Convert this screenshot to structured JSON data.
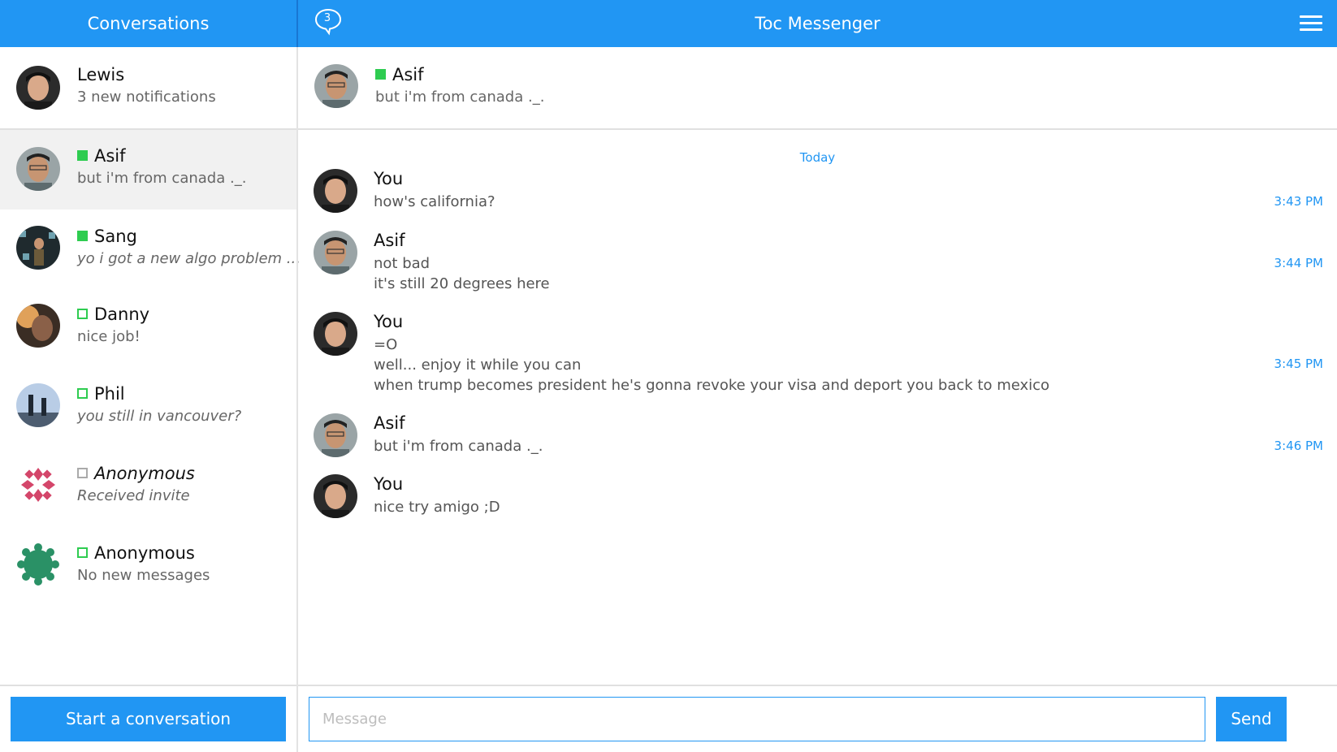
{
  "header": {
    "conversations_title": "Conversations",
    "app_title": "Toc Messenger",
    "notification_count": "3"
  },
  "profile": {
    "name": "Lewis",
    "subtitle": "3 new notifications"
  },
  "conversations": [
    {
      "name": "Asif",
      "preview": "but i'm from canada ._.",
      "status": "online",
      "selected": true
    },
    {
      "name": "Sang",
      "preview": "yo i got a new algo problem ...",
      "status": "online"
    },
    {
      "name": "Danny",
      "preview": "nice job!",
      "status": "offline"
    },
    {
      "name": "Phil",
      "preview": "you still in vancouver?",
      "status": "offline"
    },
    {
      "name": "Anonymous",
      "preview": "Received invite",
      "status": "invited"
    },
    {
      "name": "Anonymous",
      "preview": "No new messages",
      "status": "offline"
    }
  ],
  "start_button": "Start a conversation",
  "chat_header": {
    "name": "Asif",
    "preview": "but i'm from canada ._.",
    "status": "online"
  },
  "date_divider": "Today",
  "messages": [
    {
      "sender": "You",
      "lines": [
        "how's california?"
      ],
      "time": "3:43 PM"
    },
    {
      "sender": "Asif",
      "lines": [
        "not bad",
        "it's still 20 degrees here"
      ],
      "time": "3:44 PM"
    },
    {
      "sender": "You",
      "lines": [
        "=O",
        "well... enjoy it while you can",
        "when trump becomes president he's gonna revoke your visa and deport you back to mexico"
      ],
      "time": "3:45 PM"
    },
    {
      "sender": "Asif",
      "lines": [
        "but i'm from canada ._."
      ],
      "time": "3:46 PM"
    },
    {
      "sender": "You",
      "lines": [
        "nice try amigo ;D"
      ],
      "time": ""
    }
  ],
  "composer": {
    "placeholder": "Message",
    "send_label": "Send"
  },
  "colors": {
    "accent": "#2196f3",
    "online": "#2ecc50",
    "selected_row": "#f1f1f1"
  }
}
